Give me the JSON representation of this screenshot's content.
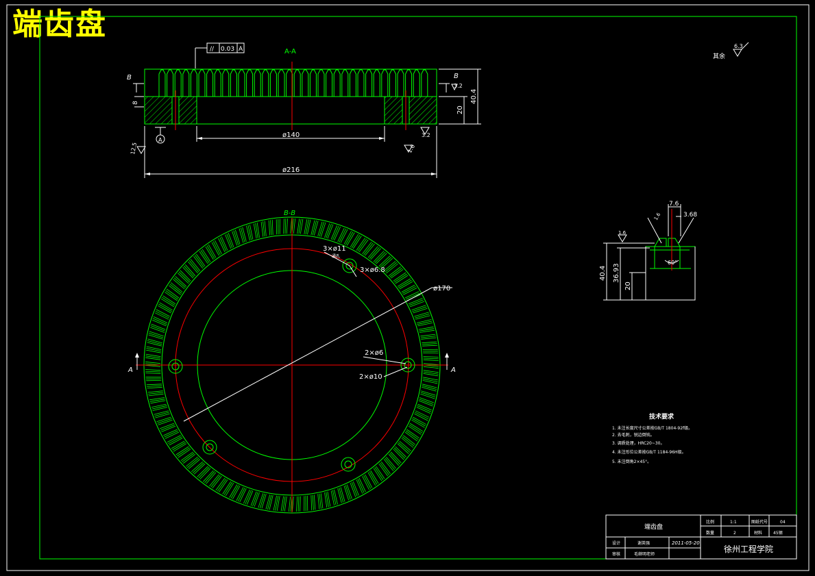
{
  "title": "端齿盘",
  "section_aa": "A-A",
  "section_bb": "B-B",
  "tolerance": {
    "symbol": "//",
    "value": "0.03",
    "datum": "A"
  },
  "labels": {
    "B_left": "B",
    "B_right": "B",
    "A_left": "A",
    "A_right": "A",
    "datum_A": "A",
    "rest_note": "其余",
    "rest_rough": "6.3"
  },
  "dims_aa": {
    "d140": "ø140",
    "d216": "ø216",
    "h8": "8",
    "h20": "20",
    "h40_4": "40.4",
    "rough_3_2a": "3.2",
    "rough_3_2b": "3.2",
    "rough_1_6": "1.6",
    "rough_12_5": "12.5"
  },
  "dims_bb": {
    "holes_11": "3×ø11",
    "holes_11_note": "通孔",
    "holes_6_8": "3×ø6.8",
    "d170": "ø170",
    "holes_6": "2×ø6",
    "holes_10": "2×ø10"
  },
  "detail": {
    "w7_6": "7.6",
    "w3_68": "3.68",
    "h40_4": "40.4",
    "h36_93": "36.93",
    "h20": "20",
    "angle": "60°",
    "rough_a": "1.6",
    "rough_b": "1.6"
  },
  "tech": {
    "title": "技术要求",
    "items": [
      "1. 未注长度尺寸公差按GB/T 1804-92f级。",
      "2. 去毛刺，锐边倒钝。",
      "3. 调质处理，HRC20~30。",
      "4. 未注形位公差按GB/T 1184-96H级。",
      "5. 未注倒角2×45°。"
    ]
  },
  "title_block": {
    "part_name": "端齿盘",
    "scale_label": "比例",
    "scale_value": "1:1",
    "drawing_no_label": "图纸代号",
    "drawing_no": "04",
    "qty_label": "数量",
    "qty_value": "2",
    "material_label": "材料",
    "material_value": "45钢",
    "design_label": "设计",
    "designer": "谢英强",
    "date": "2011-05-20",
    "review_label": "审核",
    "reviewer": "毛继明老师",
    "school": "徐州工程学院"
  },
  "colors": {
    "background": "#000000",
    "outline": "#00ff00",
    "center": "#ff0000",
    "dimension": "#ffffff",
    "title": "#ffff00",
    "section_label": "#00ff00"
  }
}
